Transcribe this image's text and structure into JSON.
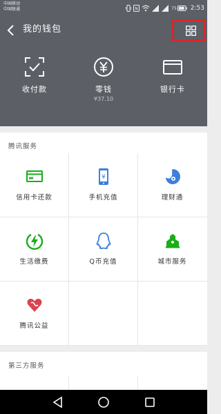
{
  "status_bar": {
    "carrier_1": "中国移动",
    "carrier_2": "中国联通",
    "battery_level": "75",
    "time": "2:53",
    "network_label": "4G"
  },
  "header": {
    "title": "我的钱包",
    "items": [
      {
        "label": "收付款",
        "icon": "scan-pay-icon"
      },
      {
        "label": "零钱",
        "sub": "¥37.10",
        "icon": "yen-coin-icon"
      },
      {
        "label": "银行卡",
        "icon": "bank-card-icon"
      }
    ]
  },
  "tencent_services": {
    "title": "腾讯服务",
    "items": [
      {
        "label": "信用卡还款",
        "icon": "credit-card-icon",
        "color": "#1aad19"
      },
      {
        "label": "手机充值",
        "icon": "phone-recharge-icon",
        "color": "#3e7fd8"
      },
      {
        "label": "理财通",
        "icon": "licaitong-icon",
        "color": "#3e7fd8"
      },
      {
        "label": "生活缴费",
        "icon": "lightning-icon",
        "color": "#1aad19"
      },
      {
        "label": "Q币充值",
        "icon": "qq-penguin-icon",
        "color": "#3e7fd8"
      },
      {
        "label": "城市服务",
        "icon": "city-icon",
        "color": "#1aad19"
      },
      {
        "label": "腾讯公益",
        "icon": "heart-charity-icon",
        "color": "#d9434f"
      }
    ]
  },
  "third_party_services": {
    "title": "第三方服务"
  },
  "colors": {
    "header_bg": "#5c5f66",
    "highlight_box": "#d9262a",
    "green": "#1aad19",
    "blue": "#3e7fd8",
    "red": "#d9434f"
  }
}
